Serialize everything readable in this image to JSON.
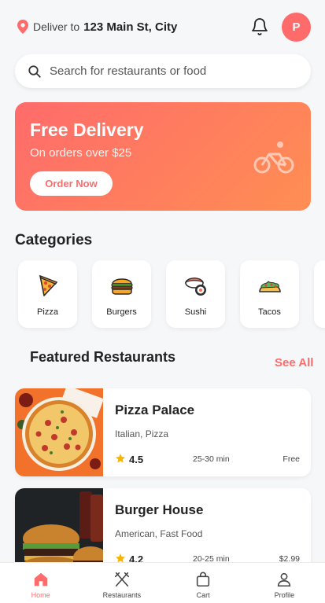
{
  "header": {
    "deliver_label": "Deliver to",
    "address": "123 Main St, City",
    "avatar_initial": "P"
  },
  "search": {
    "placeholder": "Search for restaurants or food"
  },
  "promo": {
    "title": "Free Delivery",
    "subtitle": "On orders over $25",
    "button": "Order Now",
    "icon": "bicycle-icon"
  },
  "categories": {
    "title": "Categories",
    "items": [
      {
        "label": "Pizza",
        "icon": "pizza-icon"
      },
      {
        "label": "Burgers",
        "icon": "burger-icon"
      },
      {
        "label": "Sushi",
        "icon": "sushi-icon"
      },
      {
        "label": "Tacos",
        "icon": "taco-icon"
      }
    ]
  },
  "featured": {
    "title": "Featured Restaurants",
    "see_all": "See All",
    "items": [
      {
        "name": "Pizza Palace",
        "cuisine": "Italian, Pizza",
        "rating": "4.5",
        "time": "25-30 min",
        "fee": "Free"
      },
      {
        "name": "Burger House",
        "cuisine": "American, Fast Food",
        "rating": "4.2",
        "time": "20-25 min",
        "fee": "$2.99"
      }
    ]
  },
  "nav": [
    {
      "label": "Home",
      "icon": "home-icon",
      "active": true
    },
    {
      "label": "Restaurants",
      "icon": "utensils-icon"
    },
    {
      "label": "Cart",
      "icon": "bag-icon"
    },
    {
      "label": "Profile",
      "icon": "user-icon"
    }
  ],
  "colors": {
    "accent": "#ff6b6b",
    "accent2": "#ff8e53"
  }
}
